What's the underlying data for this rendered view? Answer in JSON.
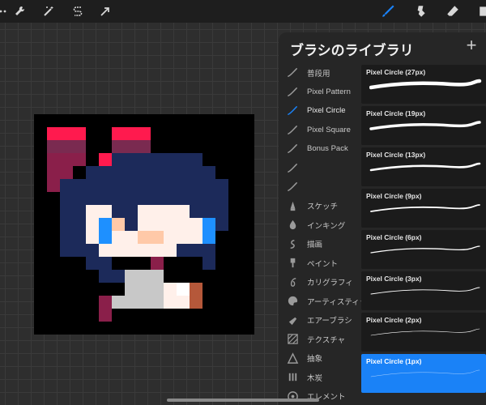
{
  "toolbar": {
    "left_icons": [
      "gallery-dots-icon",
      "wrench-icon",
      "magic-wand-icon",
      "selection-s-icon",
      "transform-arrow-icon"
    ],
    "right_icons": [
      "brush-icon",
      "smudge-icon",
      "eraser-icon",
      "layers-icon"
    ],
    "accent": "#1a82f7"
  },
  "brush_library": {
    "title": "ブラシのライブラリ",
    "add_label": "+",
    "sets": [
      {
        "label": "普段用",
        "icon": "brush-stroke-icon"
      },
      {
        "label": "Pixel Pattern",
        "icon": "brush-stroke-icon"
      },
      {
        "label": "Pixel Circle",
        "icon": "brush-stroke-icon",
        "active": true
      },
      {
        "label": "Pixel Square",
        "icon": "brush-stroke-icon"
      },
      {
        "label": "Bonus Pack",
        "icon": "brush-stroke-icon"
      },
      {
        "label": "",
        "icon": "brush-stroke-icon"
      },
      {
        "label": "",
        "icon": "brush-stroke-icon"
      },
      {
        "label": "スケッチ",
        "icon": "pencil-tip-icon"
      },
      {
        "label": "インキング",
        "icon": "ink-drop-icon"
      },
      {
        "label": "描画",
        "icon": "swirl-icon"
      },
      {
        "label": "ペイント",
        "icon": "paint-brush-icon"
      },
      {
        "label": "カリグラフィ",
        "icon": "calligraphy-icon"
      },
      {
        "label": "アーティスティック",
        "icon": "palette-icon"
      },
      {
        "label": "エアーブラシ",
        "icon": "airbrush-icon"
      },
      {
        "label": "テクスチャ",
        "icon": "texture-icon"
      },
      {
        "label": "抽象",
        "icon": "triangle-icon"
      },
      {
        "label": "木炭",
        "icon": "charcoal-icon"
      },
      {
        "label": "エレメント",
        "icon": "element-icon"
      }
    ],
    "brushes": [
      {
        "name": "Pixel Circle (27px)",
        "stroke": 4.5
      },
      {
        "name": "Pixel Circle (19px)",
        "stroke": 3.5
      },
      {
        "name": "Pixel Circle (13px)",
        "stroke": 2.6
      },
      {
        "name": "Pixel Circle (9px)",
        "stroke": 1.8
      },
      {
        "name": "Pixel Circle (6px)",
        "stroke": 1.3
      },
      {
        "name": "Pixel Circle (3px)",
        "stroke": 0.9
      },
      {
        "name": "Pixel Circle (2px)",
        "stroke": 0.6
      },
      {
        "name": "Pixel Circle (1px)",
        "stroke": 0.4,
        "active": true
      }
    ]
  },
  "artwork": {
    "palette": {
      "k": "#000000",
      "r": "#ff1a4e",
      "m": "#7a2a50",
      "q": "#8a1f4a",
      "n": "#1c2a5a",
      "s": "#fff0ea",
      "t": "#ffc9a8",
      "b": "#1e90ff",
      "g": "#c8c8c8",
      "w": "#ffffff",
      "o": "#b5583a"
    }
  }
}
